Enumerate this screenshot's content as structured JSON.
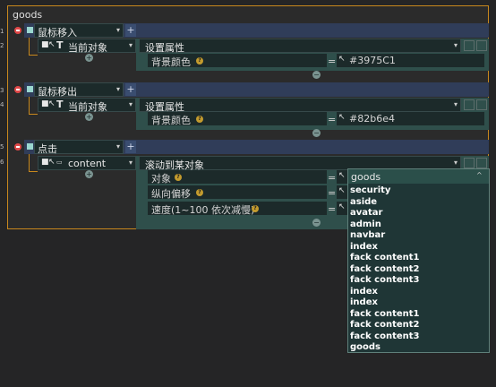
{
  "component": {
    "title": "goods"
  },
  "gutter": [
    "1",
    "2",
    "3",
    "4",
    "5",
    "6"
  ],
  "blocks": [
    {
      "event": "鼠标移入",
      "target": "当前对象",
      "action": "设置属性",
      "param_label": "背景颜色",
      "param_value": "#3975C1"
    },
    {
      "event": "鼠标移出",
      "target": "当前对象",
      "action": "设置属性",
      "param_label": "背景颜色",
      "param_value": "#82b6e4"
    },
    {
      "event": "点击",
      "target": "content",
      "target_icon": "image-icon",
      "action": "滚动到某对象",
      "params": [
        {
          "label": "对象"
        },
        {
          "label": "纵向偏移"
        },
        {
          "label": "速度(1~100 依次减慢)"
        }
      ]
    }
  ],
  "dropdown": {
    "selected": "goods",
    "options": [
      "security",
      "aside",
      "avatar",
      "admin",
      "navbar",
      "index",
      "fack content1",
      "fack content2",
      "fack content3",
      "index",
      "index",
      "fack content1",
      "fack content2",
      "fack content3",
      "goods"
    ]
  },
  "misc": {
    "eq": "="
  },
  "colors": {
    "frame_border": "#c8881d",
    "header_bg": "#303d59",
    "panel_green": "#2f4f4b",
    "delete_red": "#e04848",
    "dropdown_bg": "#1f3636"
  }
}
